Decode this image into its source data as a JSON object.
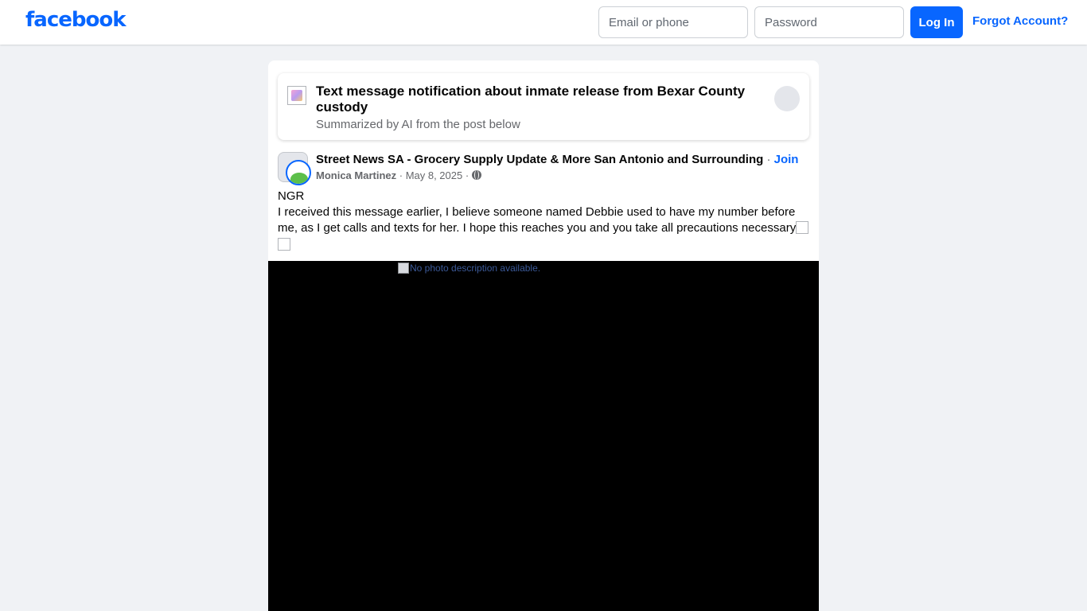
{
  "header": {
    "logo": "facebook",
    "email_placeholder": "Email or phone",
    "password_placeholder": "Password",
    "login_label": "Log In",
    "forgot_label": "Forgot Account?"
  },
  "summary": {
    "title": "Text message notification about inmate release from Bexar County custody",
    "subtitle": "Summarized by AI from the post below"
  },
  "post": {
    "group": "Street News SA - Grocery Supply Update & More San Antonio and Surrounding",
    "separator": " · ",
    "join_label": "Join",
    "author": "Monica Martinez",
    "date": "May 8, 2025",
    "text_line1": "NGR",
    "text_line2": " I received this message earlier, I believe someone named Debbie used to have my number before me, as I get calls and texts for her. I hope this reaches you and you take all precautions necessary",
    "image_alt": "No photo description available."
  },
  "colors": {
    "brand": "#0866ff",
    "background": "#f0f2f5",
    "secondary_text": "#65676b"
  }
}
